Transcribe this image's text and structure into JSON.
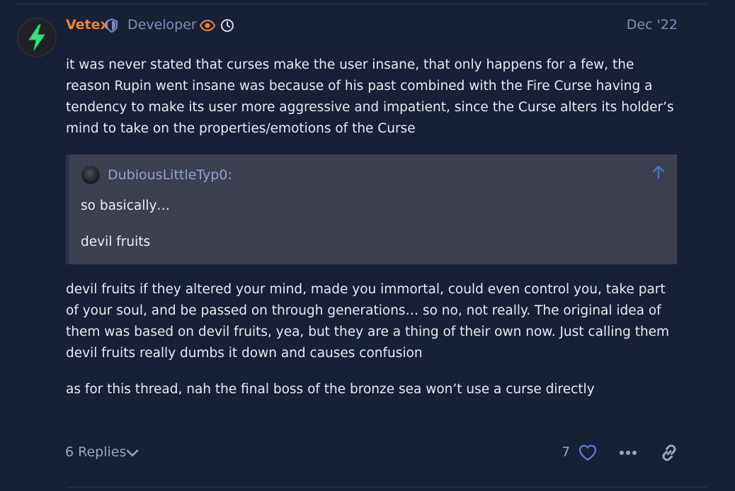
{
  "post": {
    "author": {
      "username": "Vetex",
      "title": "Developer",
      "badge_icon": "shield-icon",
      "status_icons": [
        "eye-icon",
        "clock-icon"
      ],
      "avatar_icon": "lightning-bolt-icon"
    },
    "date": "Dec '22",
    "paragraph_1": "it was never stated that curses make the user insane, that only happens for a few, the reason Rupin went insane was because of his past combined with the Fire Curse having a tendency to make its user more aggressive and impatient, since the Curse alters its holder’s mind to take on the properties/emotions of the Curse",
    "quote": {
      "author": "DubiousLittleTyp0:",
      "lines": [
        "so basically…",
        "devil fruits"
      ],
      "expand_icon": "arrow-up-icon"
    },
    "paragraph_2": "devil fruits if they altered your mind, made you immortal, could even control you, take part of your soul, and be passed on through generations… so no, not really. The original idea of them was based on devil fruits, yea, but they are a thing of their own now. Just calling them devil fruits really dumbs it down and causes confusion",
    "paragraph_3": "as for this thread, nah the final boss of the bronze sea won’t use a curse directly"
  },
  "actions": {
    "replies_label": "6 Replies",
    "like_count": "7",
    "icons": [
      "chevron-down-icon",
      "heart-icon",
      "more-icon",
      "link-icon"
    ]
  },
  "colors": {
    "background": "#182036",
    "username": "#e8823a",
    "accent_blue": "#7f8cbe",
    "quote_background": "#3c404f",
    "bolt_green": "#35e07a"
  }
}
